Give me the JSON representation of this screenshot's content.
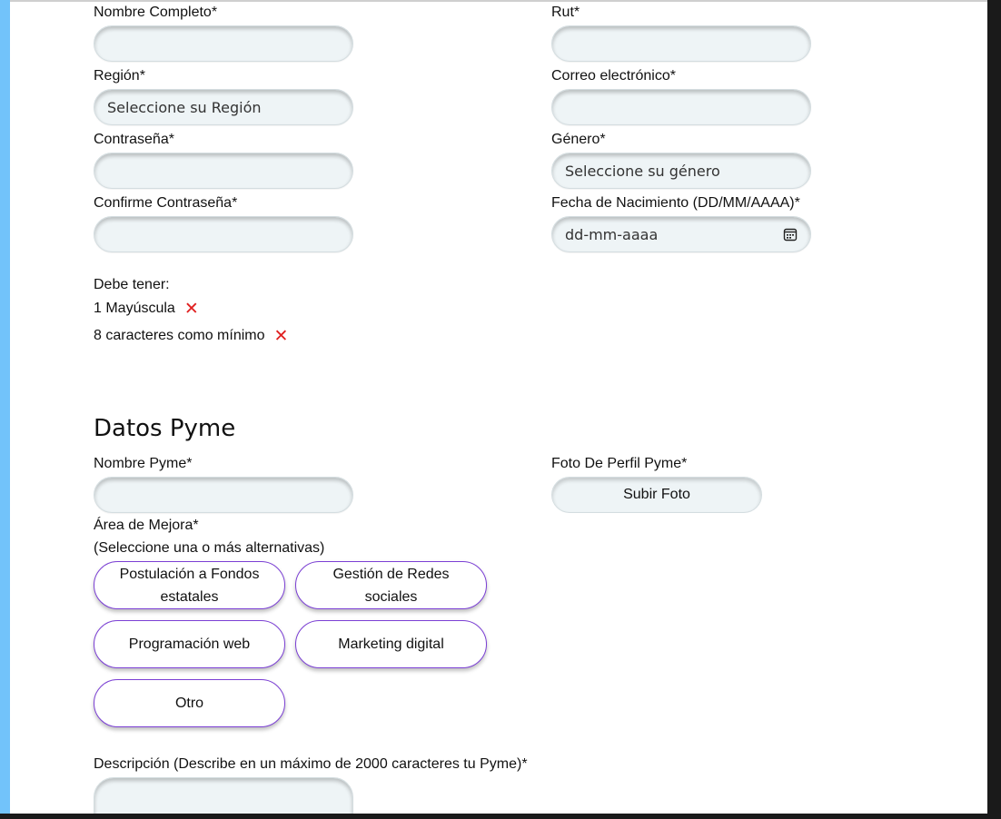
{
  "personal": {
    "fields": [
      {
        "label": "Nombre Completo*",
        "placeholder": ""
      },
      {
        "label": "Rut*",
        "placeholder": ""
      },
      {
        "label": "Región*",
        "placeholder": "Seleccione su Región"
      },
      {
        "label": "Correo electrónico*",
        "placeholder": ""
      },
      {
        "label": "Contraseña*",
        "placeholder": ""
      },
      {
        "label": "Género*",
        "placeholder": "Seleccione su género"
      },
      {
        "label": "Confirme Contraseña*",
        "placeholder": ""
      },
      {
        "label": "Fecha de Nacimiento (DD/MM/AAAA)*",
        "placeholder": "dd-mm-aaaa"
      }
    ],
    "password_rules": {
      "title": "Debe tener:",
      "items": [
        "1 Mayúscula",
        "8 caracteres como mínimo"
      ],
      "status_icon": "x-mark-icon",
      "status_color": "#e02020"
    }
  },
  "pyme": {
    "section_title": "Datos Pyme",
    "name_label": "Nombre Pyme*",
    "photo_label": "Foto De Perfil Pyme*",
    "photo_button": "Subir Foto",
    "area_label": "Área de Mejora*",
    "area_hint": "(Seleccione una o más alternativas)",
    "areas": [
      "Postulación a Fondos estatales",
      "Gestión de Redes sociales",
      "Programación web",
      "Marketing digital",
      "Otro"
    ],
    "description_label": "Descripción (Describe en un máximo de 2000 caracteres tu Pyme)*"
  },
  "colors": {
    "accent_bar": "#72c3fa",
    "chip_border": "#7b3fd4",
    "input_bg": "#eef4f6"
  }
}
